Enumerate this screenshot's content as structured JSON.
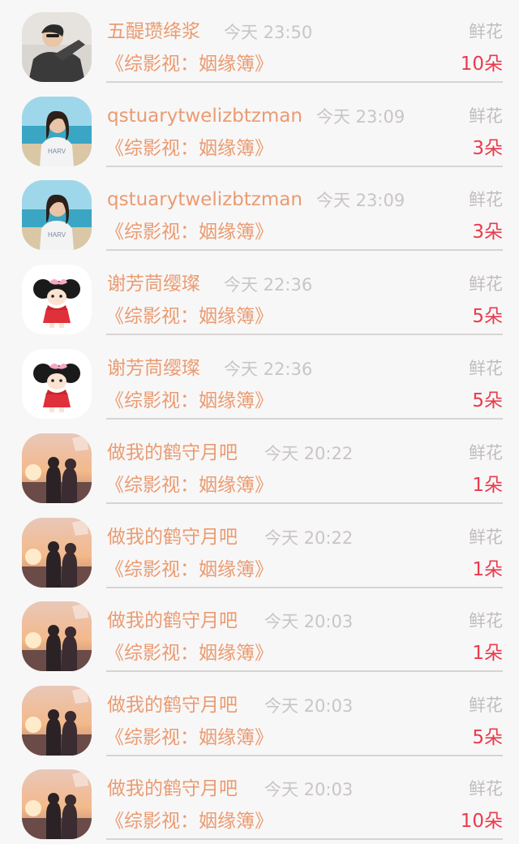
{
  "items": [
    {
      "name": "五醍瓒绛浆",
      "time": "今天 23:50",
      "gift": "鲜花",
      "title": "《综影视：姻缘簿》",
      "count": "10朵",
      "avatar": "person-dark"
    },
    {
      "name": "qstuarytwelizbtzman",
      "time": "今天 23:09",
      "gift": "鲜花",
      "title": "《综影视：姻缘簿》",
      "count": "3朵",
      "avatar": "beach-girl"
    },
    {
      "name": "qstuarytwelizbtzman",
      "time": "今天 23:09",
      "gift": "鲜花",
      "title": "《综影视：姻缘簿》",
      "count": "3朵",
      "avatar": "beach-girl"
    },
    {
      "name": "谢芳茼缨璨",
      "time": "今天 22:36",
      "gift": "鲜花",
      "title": "《综影视：姻缘簿》",
      "count": "5朵",
      "avatar": "cartoon-girl"
    },
    {
      "name": "谢芳茼缨璨",
      "time": "今天 22:36",
      "gift": "鲜花",
      "title": "《综影视：姻缘簿》",
      "count": "5朵",
      "avatar": "cartoon-girl"
    },
    {
      "name": "做我的鹤守月吧",
      "time": "今天 20:22",
      "gift": "鲜花",
      "title": "《综影视：姻缘簿》",
      "count": "1朵",
      "avatar": "sunset-couple"
    },
    {
      "name": "做我的鹤守月吧",
      "time": "今天 20:22",
      "gift": "鲜花",
      "title": "《综影视：姻缘簿》",
      "count": "1朵",
      "avatar": "sunset-couple"
    },
    {
      "name": "做我的鹤守月吧",
      "time": "今天 20:03",
      "gift": "鲜花",
      "title": "《综影视：姻缘簿》",
      "count": "1朵",
      "avatar": "sunset-couple"
    },
    {
      "name": "做我的鹤守月吧",
      "time": "今天 20:03",
      "gift": "鲜花",
      "title": "《综影视：姻缘簿》",
      "count": "5朵",
      "avatar": "sunset-couple"
    },
    {
      "name": "做我的鹤守月吧",
      "time": "今天 20:03",
      "gift": "鲜花",
      "title": "《综影视：姻缘簿》",
      "count": "10朵",
      "avatar": "sunset-couple"
    }
  ],
  "colors": {
    "name": "#ea9b71",
    "count": "#ea3a4d",
    "muted": "#c9c5c5",
    "background": "#f8f7f7"
  }
}
